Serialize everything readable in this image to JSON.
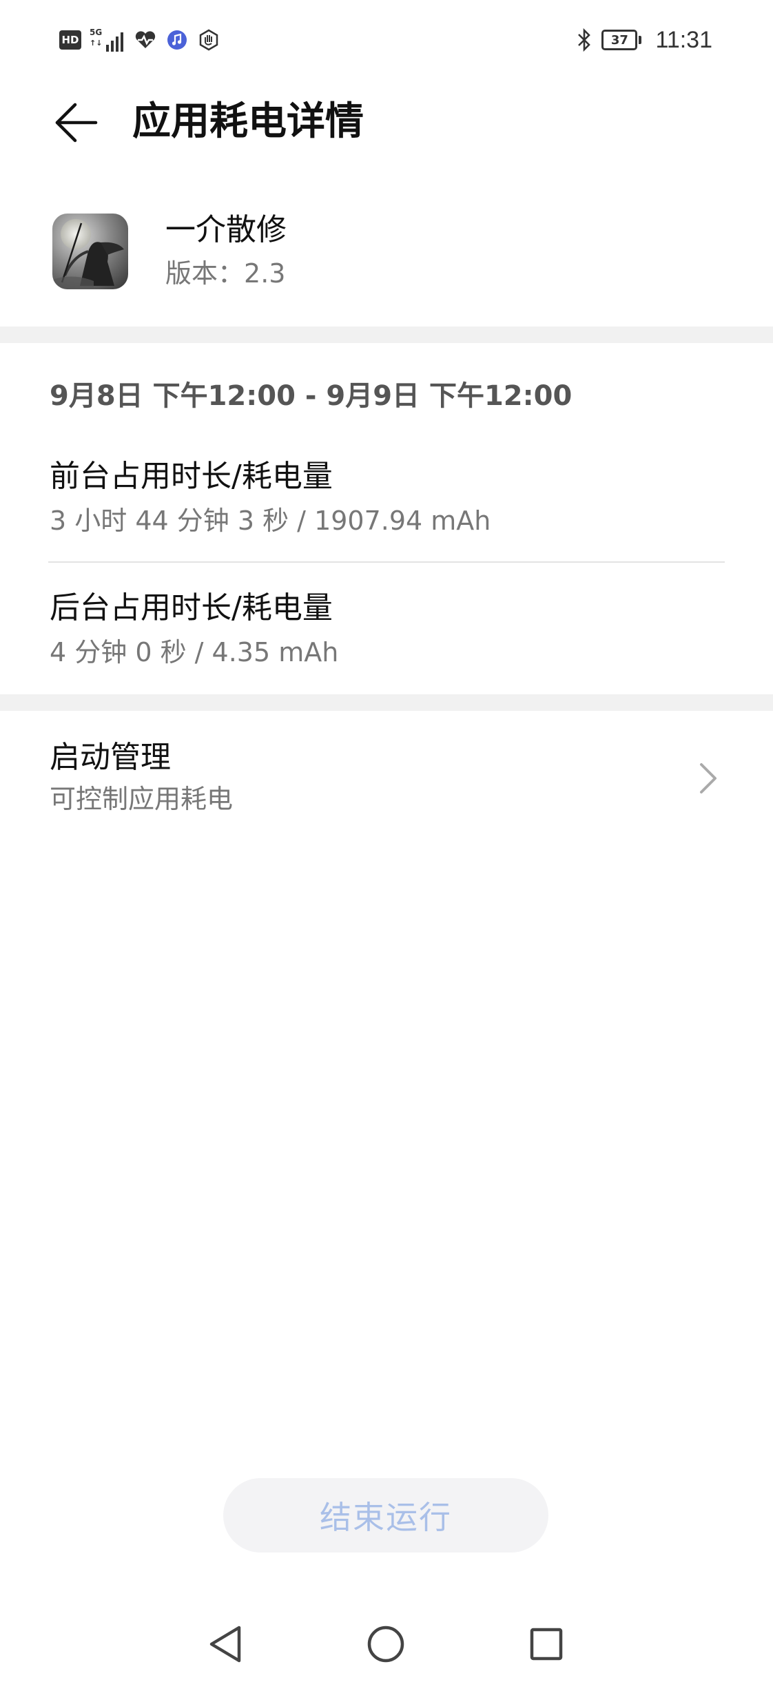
{
  "status_bar": {
    "hd": "HD",
    "network": "5G",
    "network_sub": "↑↓",
    "battery_level": "37",
    "time": "11:31",
    "icons": [
      "hd-icon",
      "signal-5g-icon",
      "health-icon",
      "music-icon",
      "hand-icon",
      "bluetooth-icon",
      "battery-icon"
    ]
  },
  "header": {
    "back_icon": "arrow-left-icon",
    "title": "应用耗电详情"
  },
  "app": {
    "name": "一介散修",
    "version_label": "版本：",
    "version_value": "2.3"
  },
  "usage": {
    "date_range": "9月8日 下午12:00 - 9月9日 下午12:00",
    "foreground": {
      "title": "前台占用时长/耗电量",
      "value": "3 小时 44 分钟 3 秒 / 1907.94 mAh"
    },
    "background": {
      "title": "后台占用时长/耗电量",
      "value": "4 分钟 0 秒 / 4.35 mAh"
    }
  },
  "startup": {
    "title": "启动管理",
    "subtitle": "可控制应用耗电",
    "chevron_icon": "chevron-right-icon"
  },
  "end_button": {
    "label": "结束运行"
  },
  "nav": {
    "back_icon": "triangle-back-icon",
    "home_icon": "circle-home-icon",
    "recents_icon": "square-recents-icon"
  },
  "colors": {
    "accent_disabled": "#a9bfe8",
    "divider": "#f1f1f1",
    "secondary_text": "#777777"
  }
}
